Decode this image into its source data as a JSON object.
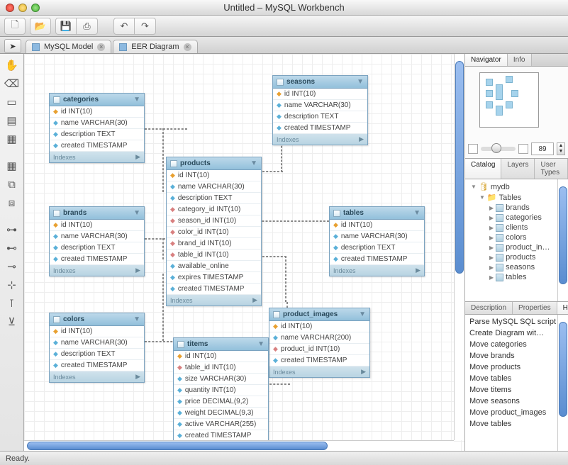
{
  "window": {
    "title": "Untitled – MySQL Workbench"
  },
  "toolbar": {
    "new": "⎘",
    "open": "📂",
    "save": "💾",
    "saveAs": "⎙",
    "undo": "↶",
    "redo": "↷"
  },
  "tabs": [
    {
      "label": "MySQL Model"
    },
    {
      "label": "EER Diagram"
    }
  ],
  "tables": {
    "categories": {
      "name": "categories",
      "rows": [
        {
          "icon": "k",
          "label": "id INT(10)"
        },
        {
          "icon": "c",
          "label": "name VARCHAR(30)"
        },
        {
          "icon": "c",
          "label": "description TEXT"
        },
        {
          "icon": "c",
          "label": "created TIMESTAMP"
        }
      ]
    },
    "seasons": {
      "name": "seasons",
      "rows": [
        {
          "icon": "k",
          "label": "id INT(10)"
        },
        {
          "icon": "c",
          "label": "name VARCHAR(30)"
        },
        {
          "icon": "c",
          "label": "description TEXT"
        },
        {
          "icon": "c",
          "label": "created TIMESTAMP"
        }
      ]
    },
    "brands": {
      "name": "brands",
      "rows": [
        {
          "icon": "k",
          "label": "id INT(10)"
        },
        {
          "icon": "c",
          "label": "name VARCHAR(30)"
        },
        {
          "icon": "c",
          "label": "description TEXT"
        },
        {
          "icon": "c",
          "label": "created TIMESTAMP"
        }
      ]
    },
    "products": {
      "name": "products",
      "rows": [
        {
          "icon": "k",
          "label": "id INT(10)"
        },
        {
          "icon": "c",
          "label": "name VARCHAR(30)"
        },
        {
          "icon": "c",
          "label": "description TEXT"
        },
        {
          "icon": "p",
          "label": "category_id INT(10)"
        },
        {
          "icon": "p",
          "label": "season_id INT(10)"
        },
        {
          "icon": "p",
          "label": "color_id INT(10)"
        },
        {
          "icon": "p",
          "label": "brand_id INT(10)"
        },
        {
          "icon": "p",
          "label": "table_id INT(10)"
        },
        {
          "icon": "c",
          "label": "available_online"
        },
        {
          "icon": "c",
          "label": "expires TIMESTAMP"
        },
        {
          "icon": "c",
          "label": "created TIMESTAMP"
        }
      ]
    },
    "tables": {
      "name": "tables",
      "rows": [
        {
          "icon": "k",
          "label": "id INT(10)"
        },
        {
          "icon": "c",
          "label": "name VARCHAR(30)"
        },
        {
          "icon": "c",
          "label": "description TEXT"
        },
        {
          "icon": "c",
          "label": "created TIMESTAMP"
        }
      ]
    },
    "colors": {
      "name": "colors",
      "rows": [
        {
          "icon": "k",
          "label": "id INT(10)"
        },
        {
          "icon": "c",
          "label": "name VARCHAR(30)"
        },
        {
          "icon": "c",
          "label": "description TEXT"
        },
        {
          "icon": "c",
          "label": "created TIMESTAMP"
        }
      ]
    },
    "product_images": {
      "name": "product_images",
      "rows": [
        {
          "icon": "k",
          "label": "id INT(10)"
        },
        {
          "icon": "c",
          "label": "name VARCHAR(200)"
        },
        {
          "icon": "p",
          "label": "product_id INT(10)"
        },
        {
          "icon": "c",
          "label": "created TIMESTAMP"
        }
      ]
    },
    "titems": {
      "name": "titems",
      "rows": [
        {
          "icon": "k",
          "label": "id INT(10)"
        },
        {
          "icon": "p",
          "label": "table_id INT(10)"
        },
        {
          "icon": "c",
          "label": "size VARCHAR(30)"
        },
        {
          "icon": "c",
          "label": "quantity INT(10)"
        },
        {
          "icon": "c",
          "label": "price DECIMAL(9,2)"
        },
        {
          "icon": "c",
          "label": "weight DECIMAL(9,3)"
        },
        {
          "icon": "c",
          "label": "active VARCHAR(255)"
        },
        {
          "icon": "c",
          "label": "created TIMESTAMP"
        }
      ]
    }
  },
  "indexesLabel": "Indexes",
  "navigator": {
    "tabs": [
      "Navigator",
      "Info"
    ],
    "zoom": "89"
  },
  "catalog": {
    "tabs": [
      "Catalog",
      "Layers",
      "User Types"
    ],
    "db": "mydb",
    "folder": "Tables",
    "items": [
      "brands",
      "categories",
      "clients",
      "colors",
      "product_in…",
      "products",
      "seasons",
      "tables"
    ]
  },
  "history": {
    "tabs": [
      "Description",
      "Properties",
      "His"
    ],
    "items": [
      "Parse MySQL SQL script",
      "Create Diagram wit…",
      "Move categories",
      "Move brands",
      "Move products",
      "Move tables",
      "Move titems",
      "Move seasons",
      "Move product_images",
      "Move tables"
    ]
  },
  "status": "Ready."
}
